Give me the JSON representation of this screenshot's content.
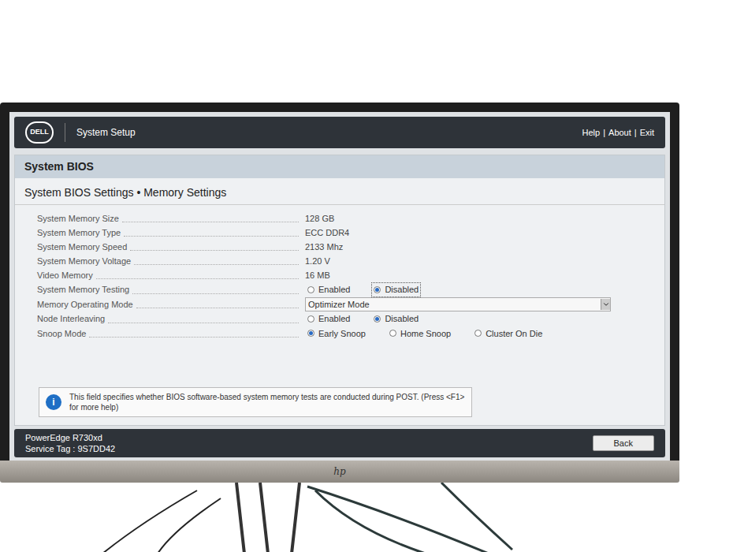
{
  "header": {
    "logo": "DELL",
    "title": "System Setup",
    "links": [
      "Help",
      "About",
      "Exit"
    ],
    "separator": "|"
  },
  "section": "System BIOS",
  "page_title": "System BIOS Settings • Memory Settings",
  "settings": [
    {
      "label": "System Memory Size",
      "kind": "text",
      "value": "128 GB",
      "focused": false
    },
    {
      "label": "System Memory Type",
      "kind": "text",
      "value": "ECC DDR4",
      "focused": false
    },
    {
      "label": "System Memory Speed",
      "kind": "text",
      "value": "2133 Mhz",
      "focused": false
    },
    {
      "label": "System Memory Voltage",
      "kind": "text",
      "value": "1.20 V",
      "focused": false
    },
    {
      "label": "Video Memory",
      "kind": "text",
      "value": "16 MB",
      "focused": false
    },
    {
      "label": "System Memory Testing",
      "kind": "radio",
      "focused": true,
      "options": [
        {
          "label": "Enabled",
          "selected": false
        },
        {
          "label": "Disabled",
          "selected": true
        }
      ]
    },
    {
      "label": "Memory Operating Mode",
      "kind": "dropdown",
      "value": "Optimizer Mode",
      "focused": false
    },
    {
      "label": "Node Interleaving",
      "kind": "radio",
      "focused": false,
      "options": [
        {
          "label": "Enabled",
          "selected": false
        },
        {
          "label": "Disabled",
          "selected": true
        }
      ]
    },
    {
      "label": "Snoop Mode",
      "kind": "radio",
      "focused": false,
      "options": [
        {
          "label": "Early Snoop",
          "selected": true
        },
        {
          "label": "Home Snoop",
          "selected": false
        },
        {
          "label": "Cluster On Die",
          "selected": false
        }
      ]
    }
  ],
  "help": {
    "icon": "i",
    "text": "This field specifies whether BIOS software-based system memory tests are conducted during POST. (Press <F1> for more help)"
  },
  "footer": {
    "model": "PowerEdge R730xd",
    "service_tag": "Service Tag : 9S7DD42",
    "button": "Back"
  },
  "monitor": {
    "brand": "hp"
  }
}
